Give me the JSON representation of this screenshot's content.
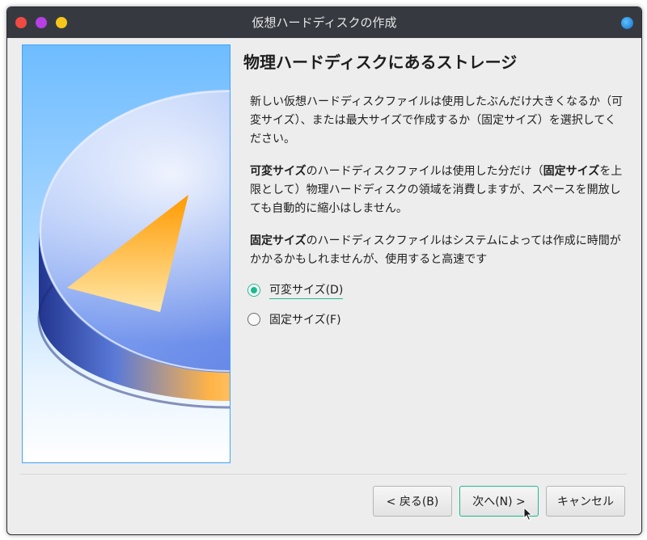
{
  "window": {
    "title": "仮想ハードディスクの作成"
  },
  "page": {
    "heading": "物理ハードディスクにあるストレージ",
    "para1": "新しい仮想ハードディスクファイルは使用したぶんだけ大きくなるか（可変サイズ）、または最大サイズで作成するか（固定サイズ）を選択してください。",
    "para2": {
      "b1": "可変サイズ",
      "t1": "のハードディスクファイルは使用した分だけ（",
      "b2": "固定サイズ",
      "t2": "を上限として）物理ハードディスクの領域を消費しますが、スペースを開放しても自動的に縮小はしません。"
    },
    "para3": {
      "b1": "固定サイズ",
      "t1": "のハードディスクファイルはシステムによっては作成に時間がかかるかもしれませんが、使用すると高速です"
    },
    "options": [
      {
        "label": "可変サイズ(D)",
        "checked": true
      },
      {
        "label": "固定サイズ(F)",
        "checked": false
      }
    ]
  },
  "buttons": {
    "back": "< 戻る(B)",
    "next": "次へ(N) >",
    "cancel": "キャンセル"
  },
  "colors": {
    "accent": "#1fb98e",
    "titlebar": "#363a40",
    "close": "#f04a42",
    "minimize": "#b640e6",
    "maximize": "#f6c51b"
  }
}
